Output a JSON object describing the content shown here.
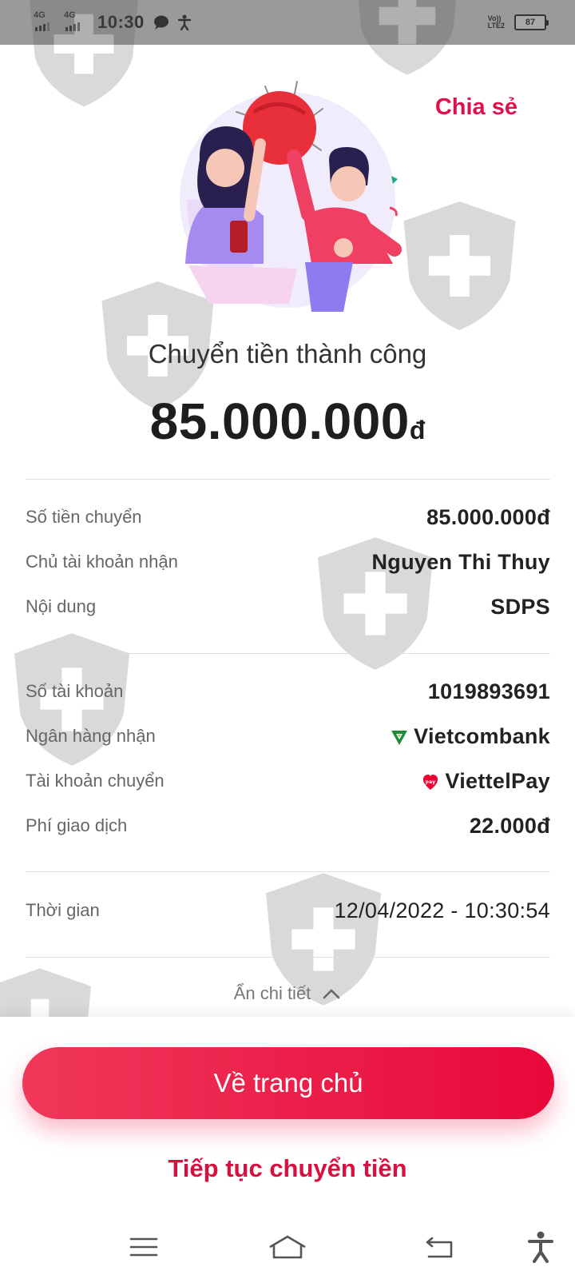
{
  "status_bar": {
    "network_1": "4G",
    "network_2": "4G",
    "time": "10:30",
    "volte_top": "Vo))",
    "volte_bottom": "LTE2",
    "battery": "87"
  },
  "header": {
    "share_label": "Chia sẻ"
  },
  "result": {
    "title": "Chuyển tiền thành công",
    "amount": "85.000.000",
    "currency": "đ"
  },
  "details_group_1": [
    {
      "label": "Số tiền chuyển",
      "value": "85.000.000đ"
    },
    {
      "label": "Chủ tài khoản nhận",
      "value": "Nguyen Thi Thuy"
    },
    {
      "label": "Nội dung",
      "value": "SDPS"
    }
  ],
  "details_group_2": [
    {
      "label": "Số tài khoản",
      "value": "1019893691"
    },
    {
      "label": "Ngân hàng nhận",
      "value": "Vietcombank",
      "icon": "vietcombank-logo-icon"
    },
    {
      "label": "Tài khoản chuyển",
      "value": "ViettelPay",
      "icon": "viettelpay-logo-icon"
    },
    {
      "label": "Phí giao dịch",
      "value": "22.000đ"
    }
  ],
  "details_group_3": [
    {
      "label": "Thời gian",
      "value": "12/04/2022 - 10:30:54"
    }
  ],
  "toggle": {
    "label": "Ẩn chi tiết",
    "icon": "chevron-up-icon"
  },
  "actions": {
    "home_label": "Về trang chủ",
    "continue_label": "Tiếp tục chuyển tiền"
  },
  "nav_bar": {
    "icons": [
      "menu-icon",
      "home-icon",
      "back-icon",
      "accessibility-icon"
    ]
  },
  "colors": {
    "accent": "#e8083a",
    "status_bar": "#9a9a9a",
    "vietcombank_green": "#1f8a3b"
  }
}
